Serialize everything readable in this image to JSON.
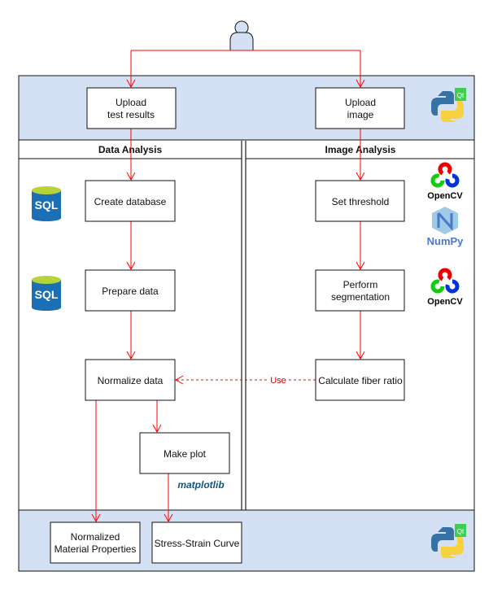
{
  "colors": {
    "band": "#d4e1f5",
    "arrow": "#ff0000",
    "border": "#111111"
  },
  "top_band": {
    "upload_results": [
      "Upload",
      "test results"
    ],
    "upload_image": [
      "Upload",
      "image"
    ],
    "icon": "python-qt-icon"
  },
  "lanes": {
    "data_analysis": {
      "title": "Data Analysis",
      "create_database": "Create database",
      "prepare_data": "Prepare data",
      "normalize_data": "Normalize data",
      "make_plot": "Make plot"
    },
    "image_analysis": {
      "title": "Image Analysis",
      "set_threshold": "Set threshold",
      "perform_segmentation": [
        "Perform",
        "segmentation"
      ],
      "calculate_fiber_ratio": "Calculate fiber ratio"
    }
  },
  "connector_label": "Use",
  "bottom_band": {
    "normalized_properties": [
      "Normalized",
      "Material Properties"
    ],
    "stress_strain": "Stress-Strain Curve"
  },
  "logos": {
    "sql": "SQL",
    "opencv": "OpenCV",
    "numpy": "NumPy",
    "matplotlib": "matplotlib"
  }
}
